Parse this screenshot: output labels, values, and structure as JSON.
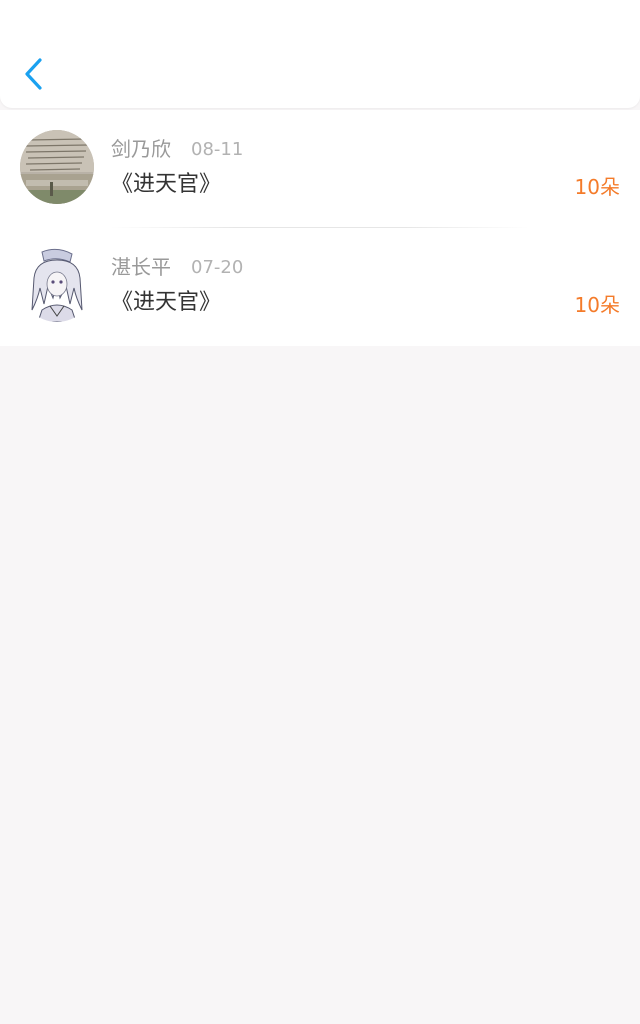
{
  "header": {
    "back_icon": "chevron-left-icon",
    "accent_color": "#1aa1f0"
  },
  "records": [
    {
      "name": "剑乃欣",
      "date": "08-11",
      "title": "《进天官》",
      "amount": "10朵",
      "avatar": "photo-of-book-page"
    },
    {
      "name": "湛长平",
      "date": "07-20",
      "title": "《进天官》",
      "amount": "10朵",
      "avatar": "anime-character-portrait"
    }
  ],
  "colors": {
    "amount": "#f47b2a",
    "background": "#f8f6f7"
  }
}
